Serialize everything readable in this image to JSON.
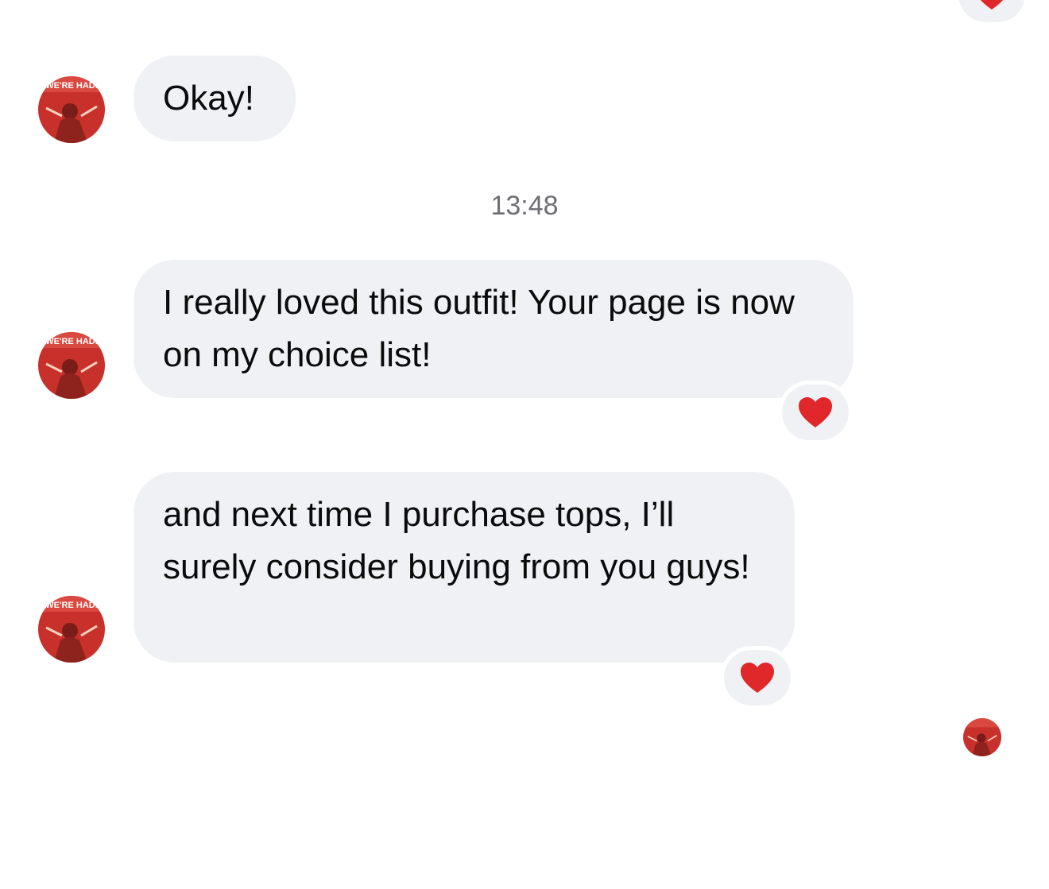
{
  "conversation": {
    "messages": [
      {
        "text": "Okay!"
      },
      {
        "text": "I really loved this outfit! Your page is now on my choice list!",
        "reaction": "heart"
      },
      {
        "text": "and next time I purchase tops, I’ll surely consider buying from you guys!",
        "reaction": "heart"
      }
    ],
    "timestamp": "13:48",
    "avatar_text": "WE'RE HADI"
  },
  "colors": {
    "bubble": "#f0f1f5",
    "heart": "#e0282a",
    "timestamp": "#6e6e73"
  },
  "icons": [
    "heart-reaction-icon",
    "avatar"
  ]
}
